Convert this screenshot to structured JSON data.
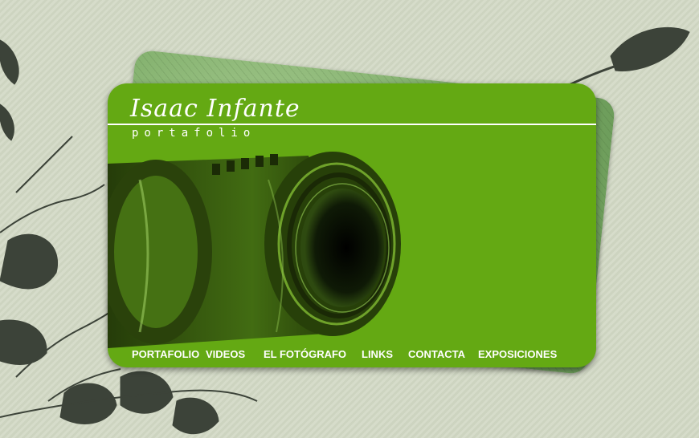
{
  "site": {
    "brand": "Isaac Infante",
    "subtitle": "portafolio"
  },
  "nav": {
    "items": [
      {
        "label": "PORTAFOLIO"
      },
      {
        "label": "VIDEOS"
      },
      {
        "label": "EL FOTÓGRAFO"
      },
      {
        "label": "LINKS"
      },
      {
        "label": "CONTACTA"
      },
      {
        "label": "EXPOSICIONES"
      }
    ]
  },
  "colors": {
    "card_green": "#64a913",
    "back_card_green": "#7fae6a",
    "background": "#d6dcca",
    "silhouette": "#3c4339",
    "text": "#ffffff"
  },
  "icons": [
    "film-reel-graphic",
    "leaf-silhouette"
  ]
}
